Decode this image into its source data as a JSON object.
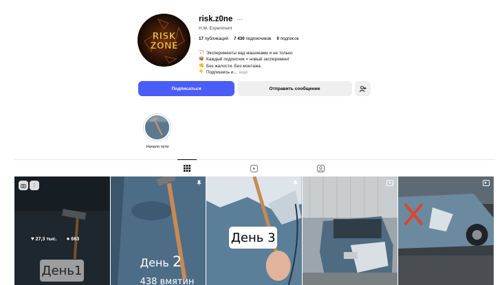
{
  "profile": {
    "username": "risk.z0ne",
    "fullname": "H.M. Experiment",
    "stats": {
      "posts_count": "17",
      "posts_label": "публикаций",
      "followers_count": "7 430",
      "followers_label": "подписчиков",
      "following_count": "0",
      "following_label": "подписок"
    },
    "bio": [
      {
        "icon": "🏹",
        "text": "Эксперименты над машинами и не только"
      },
      {
        "icon": "📦",
        "text": "Каждый подписчик = новый эксперимент"
      },
      {
        "icon": "👊",
        "text": "Без жалости. Без монтажа."
      },
      {
        "icon": "👇",
        "text": "Подпишись и..."
      }
    ],
    "bio_more": "ещё",
    "avatar_text_top": "RISK",
    "avatar_text_bottom": "ZONE"
  },
  "actions": {
    "follow_label": "Подписаться",
    "message_label": "Отправить сообщение"
  },
  "highlights": [
    {
      "label": "Начало пути"
    }
  ],
  "tabs": [
    {
      "icon": "grid-icon",
      "active": true
    },
    {
      "icon": "reels-icon",
      "active": false
    },
    {
      "icon": "tagged-icon",
      "active": false
    }
  ],
  "posts": [
    {
      "likes": "27,3 тыс.",
      "comments": "663",
      "caption": "День1"
    },
    {
      "caption_prefix": "День",
      "caption_num": "2",
      "views": "438 вмятин"
    },
    {
      "caption": "День 3"
    },
    {},
    {}
  ],
  "colors": {
    "accent": "#4a5df9",
    "secondary_button": "#efefef"
  }
}
